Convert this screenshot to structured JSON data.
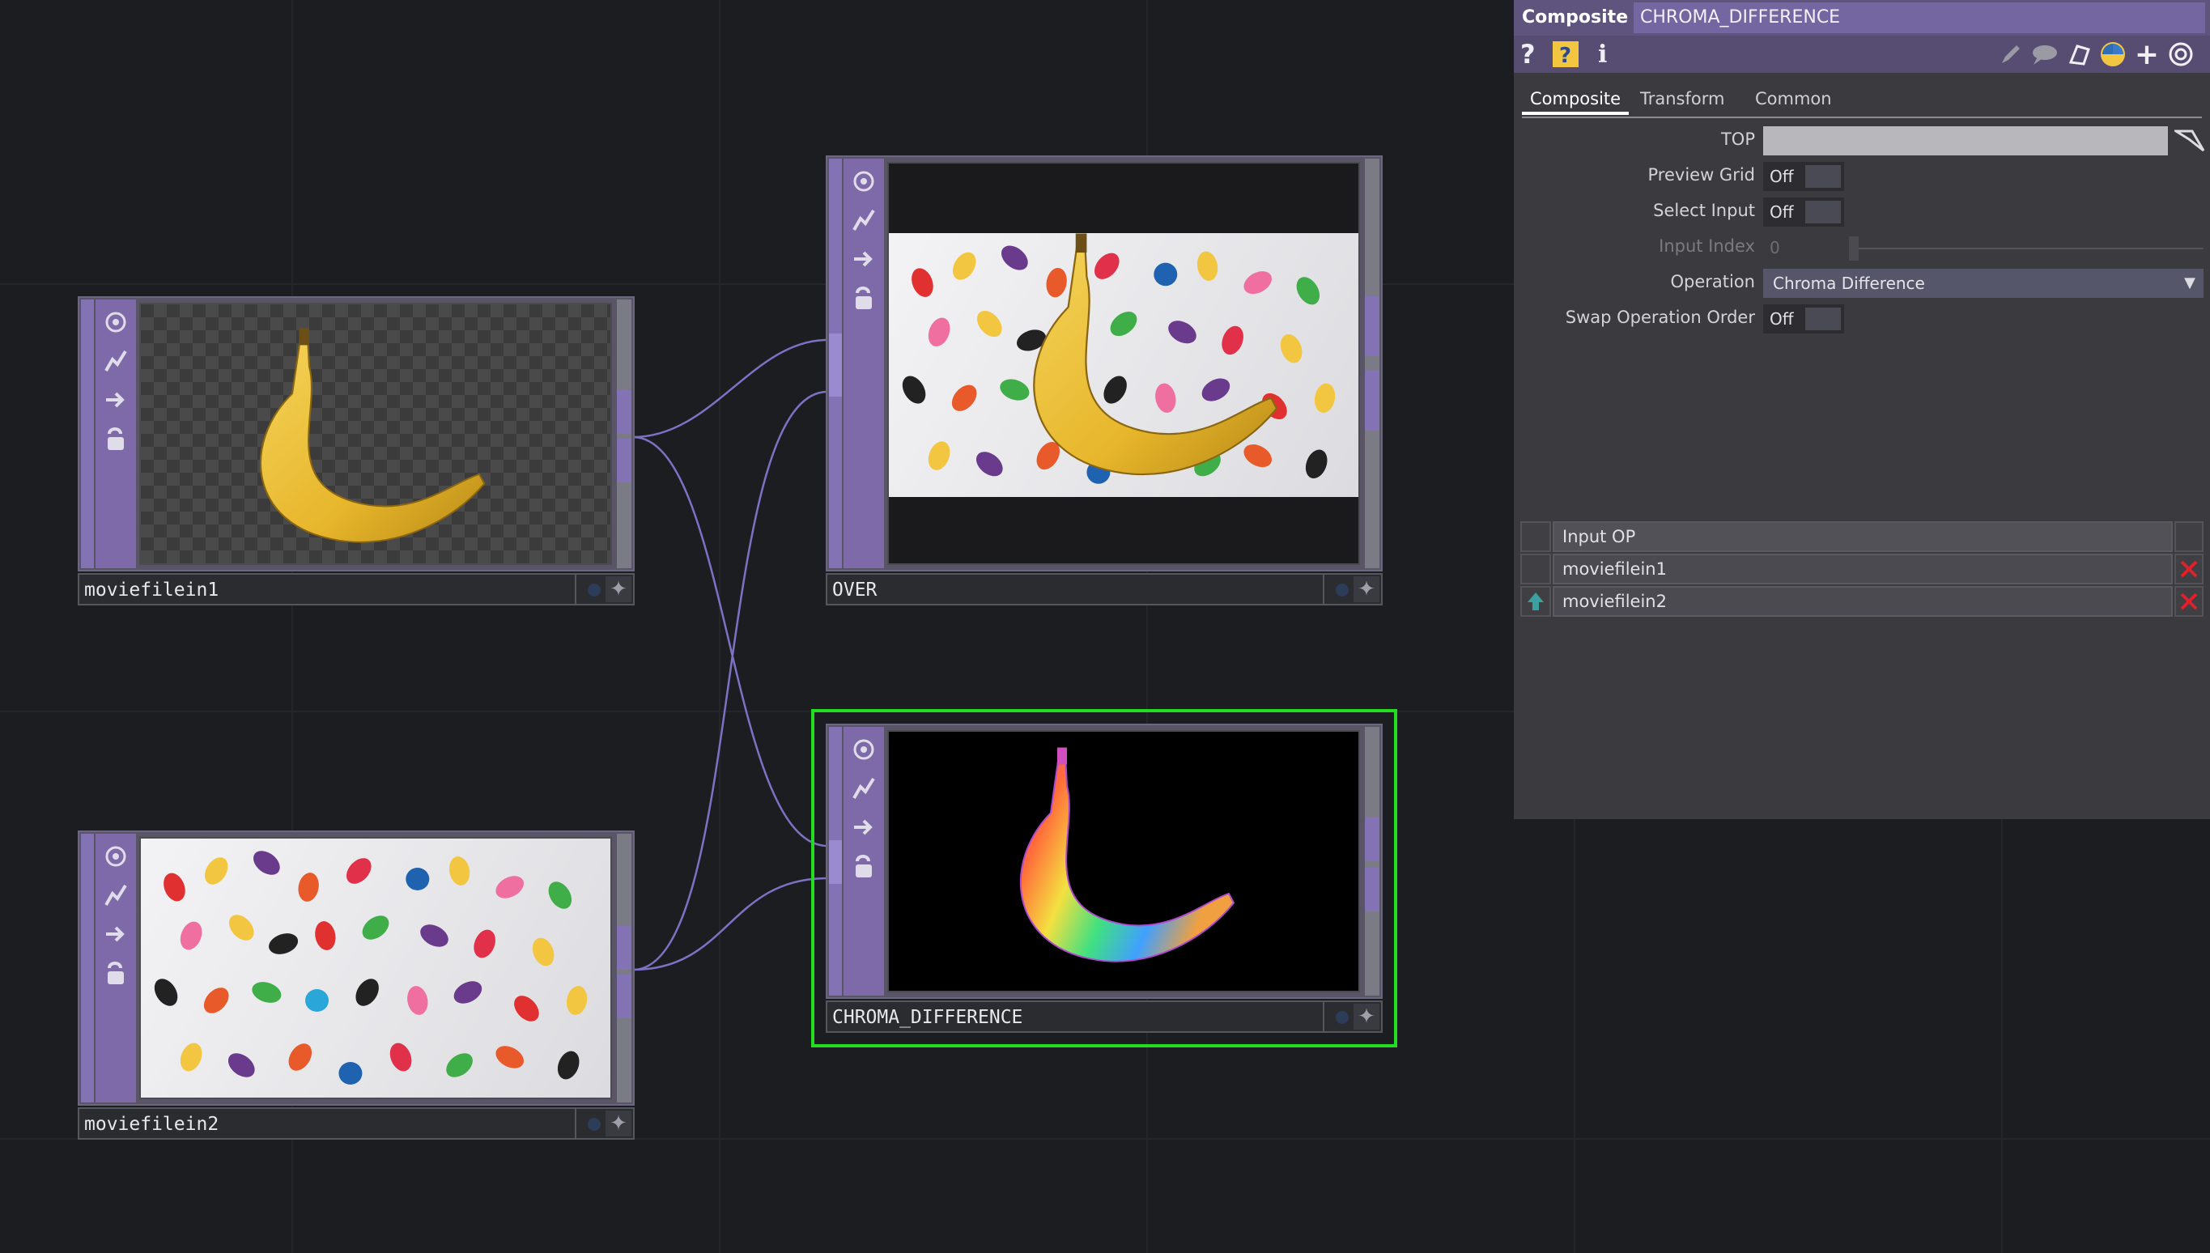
{
  "network": {
    "nodes": [
      {
        "id": "moviefilein1",
        "name": "moviefilein1",
        "content": "banana-on-transparent"
      },
      {
        "id": "moviefilein2",
        "name": "moviefilein2",
        "content": "jellybeans"
      },
      {
        "id": "over",
        "name": "OVER",
        "content": "banana-over-jellybeans"
      },
      {
        "id": "chroma",
        "name": "CHROMA_DIFFERENCE",
        "content": "chroma-difference-banana",
        "selected": true
      }
    ],
    "node_icons": [
      "viewer-icon",
      "bypass-icon",
      "cook-arrow-icon",
      "lock-icon"
    ],
    "wire_color": "#7e71c4",
    "selection_color": "#22dd22"
  },
  "panel": {
    "op_type": "Composite",
    "op_name": "CHROMA_DIFFERENCE",
    "header_icons": [
      "help-icon",
      "python-help-icon",
      "info-icon",
      "edit-icon",
      "comment-icon",
      "clear-icon",
      "python-icon",
      "add-icon",
      "target-icon"
    ],
    "tabs": [
      "Composite",
      "Transform",
      "Common"
    ],
    "active_tab": "Composite",
    "params": {
      "top": {
        "label": "TOP",
        "value": ""
      },
      "preview_grid": {
        "label": "Preview Grid",
        "value": "Off"
      },
      "select_input": {
        "label": "Select Input",
        "value": "Off"
      },
      "input_index": {
        "label": "Input Index",
        "value": "0"
      },
      "operation": {
        "label": "Operation",
        "value": "Chroma Difference"
      },
      "swap_operation_order": {
        "label": "Swap Operation Order",
        "value": "Off"
      }
    },
    "input_table": {
      "header": "Input OP",
      "rows": [
        "moviefilein1",
        "moviefilein2"
      ]
    }
  }
}
